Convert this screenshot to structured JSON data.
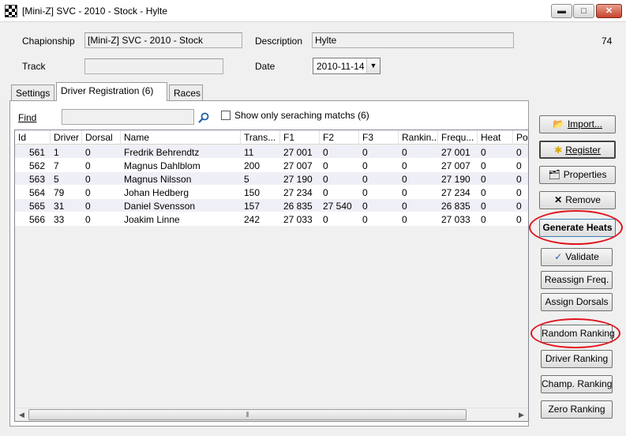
{
  "window": {
    "title": "[Mini-Z] SVC - 2010 - Stock - Hylte",
    "minimize_glyph": "▬",
    "maximize_glyph": "□",
    "close_glyph": "✕"
  },
  "header": {
    "championship_label": "Chapionship",
    "championship_value": "[Mini-Z] SVC - 2010 - Stock",
    "description_label": "Description",
    "description_value": "Hylte",
    "count": "74",
    "track_label": "Track",
    "track_value": "",
    "date_label": "Date",
    "date_value": "2010-11-14"
  },
  "tabs": [
    {
      "label": "Settings"
    },
    {
      "label": "Driver Registration (6)"
    },
    {
      "label": "Races"
    }
  ],
  "find": {
    "label": "Find",
    "value": "",
    "show_only_label": "Show only seraching matchs (6)"
  },
  "grid": {
    "columns": [
      "Id",
      "Driver",
      "Dorsal",
      "Name",
      "Trans...",
      "F1",
      "F2",
      "F3",
      "Rankin...",
      "Frequ...",
      "Heat",
      "Po"
    ],
    "rows": [
      [
        "561",
        "1",
        "0",
        "Fredrik Behrendtz",
        "11",
        "27 001",
        "0",
        "0",
        "0",
        "27 001",
        "0",
        "0"
      ],
      [
        "562",
        "7",
        "0",
        "Magnus Dahlblom",
        "200",
        "27 007",
        "0",
        "0",
        "0",
        "27 007",
        "0",
        "0"
      ],
      [
        "563",
        "5",
        "0",
        "Magnus Nilsson",
        "5",
        "27 190",
        "0",
        "0",
        "0",
        "27 190",
        "0",
        "0"
      ],
      [
        "564",
        "79",
        "0",
        "Johan Hedberg",
        "150",
        "27 234",
        "0",
        "0",
        "0",
        "27 234",
        "0",
        "0"
      ],
      [
        "565",
        "31",
        "0",
        "Daniel Svensson",
        "157",
        "26 835",
        "27 540",
        "0",
        "0",
        "26 835",
        "0",
        "0"
      ],
      [
        "566",
        "33",
        "0",
        "Joakim Linne",
        "242",
        "27 033",
        "0",
        "0",
        "0",
        "27 033",
        "0",
        "0"
      ]
    ]
  },
  "buttons": {
    "import": "Import...",
    "register": "Register",
    "properties": "Properties",
    "remove": "Remove",
    "generate_heats": "Generate Heats",
    "validate": "Validate",
    "reassign_freq": "Reassign Freq.",
    "assign_dorsals": "Assign Dorsals",
    "random_ranking": "Random Ranking",
    "driver_ranking": "Driver Ranking",
    "champ_ranking": "Champ. Ranking",
    "zero_ranking": "Zero Ranking"
  },
  "colors": {
    "highlight_circle": "#e0141c",
    "alt_row": "#efeff7"
  }
}
